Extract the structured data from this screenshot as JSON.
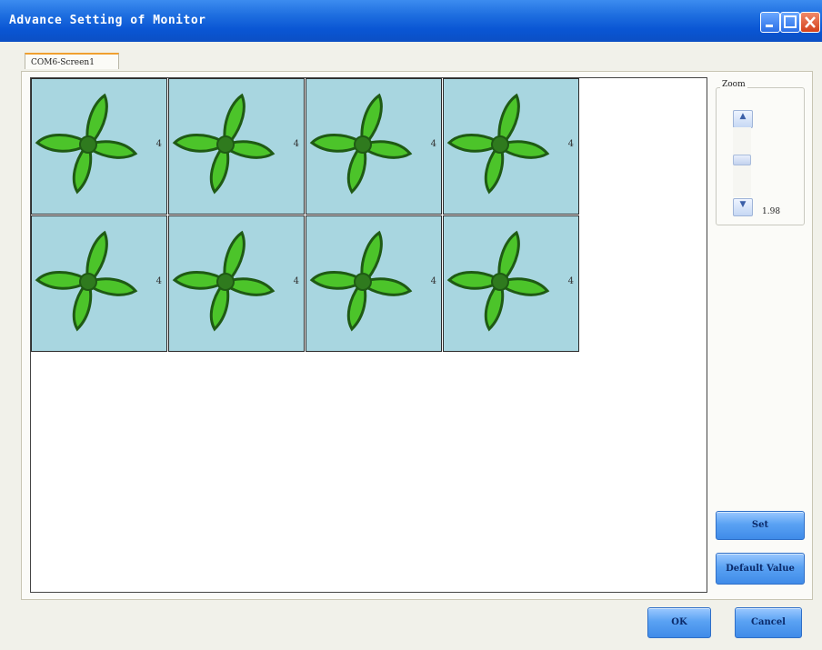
{
  "window": {
    "title": "Advance Setting of Monitor"
  },
  "tabs": [
    {
      "label": "COM6-Screen1"
    }
  ],
  "screen_grid": {
    "rows": 2,
    "cols": 4,
    "cells": [
      {
        "label": "4"
      },
      {
        "label": "4"
      },
      {
        "label": "4"
      },
      {
        "label": "4"
      },
      {
        "label": "4"
      },
      {
        "label": "4"
      },
      {
        "label": "4"
      },
      {
        "label": "4"
      }
    ],
    "icon": "fan-icon",
    "cell_color": "#a8d6e0",
    "fan_color": "#4cc42a"
  },
  "zoom": {
    "label": "Zoom",
    "value": "1.98",
    "up_icon": "chevron-up-icon",
    "down_icon": "chevron-down-icon"
  },
  "buttons": {
    "set": "Set",
    "default_value": "Default Value",
    "ok": "OK",
    "cancel": "Cancel"
  },
  "colors": {
    "titlebar": "#0a56d4",
    "button": "#5aa2f3"
  }
}
